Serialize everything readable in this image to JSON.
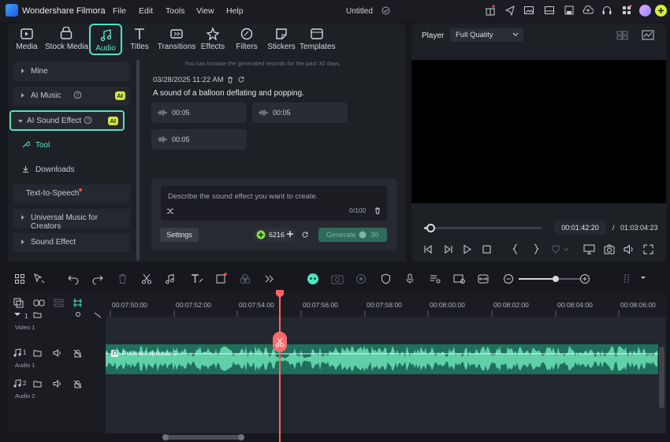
{
  "app": {
    "name": "Wondershare Filmora",
    "menu": [
      "File",
      "Edit",
      "Tools",
      "View",
      "Help"
    ],
    "doc_title": "Untitled"
  },
  "media_tabs": [
    {
      "label": "Media",
      "icon": "media-icon"
    },
    {
      "label": "Stock Media",
      "icon": "stock-media-icon"
    },
    {
      "label": "Audio",
      "icon": "music-note-icon",
      "active": true
    },
    {
      "label": "Titles",
      "icon": "titles-icon"
    },
    {
      "label": "Transitions",
      "icon": "transitions-icon"
    },
    {
      "label": "Effects",
      "icon": "effects-icon"
    },
    {
      "label": "Filters",
      "icon": "filters-icon"
    },
    {
      "label": "Stickers",
      "icon": "stickers-icon"
    },
    {
      "label": "Templates",
      "icon": "templates-icon"
    }
  ],
  "sidebar": {
    "mine": "Mine",
    "ai_music": "AI Music",
    "ai_sound_effect": "AI Sound Effect",
    "ai_badge": "AI",
    "tool": "Tool",
    "downloads": "Downloads",
    "tts": "Text-to-Speech",
    "universal_music": "Universal Music for Creators",
    "sound_effect": "Sound Effect"
  },
  "records": {
    "note": "You can browse the generated records for the past 30 days.",
    "date": "03/28/2025 11:22 AM",
    "description": "A sound of a balloon deflating and popping.",
    "clips": [
      "00:05",
      "00:05",
      "00:05"
    ]
  },
  "prompt": {
    "placeholder": "Describe the sound effect you want to create.",
    "count": "0/100",
    "settings_label": "Settings",
    "credits": "6216",
    "generate_label": "Generate",
    "generate_cost": "30"
  },
  "player": {
    "label": "Player",
    "quality": "Full Quality",
    "current_time": "00:01:42:20",
    "separator": "/",
    "total_time": "01:03:04:23",
    "progress": 0.05
  },
  "timeline": {
    "ticks": [
      "00:07:50:00",
      "00:07:52:00",
      "00:07:54:00",
      "00:07:56:00",
      "00:07:58:00",
      "00:08:00:00",
      "00:08:02:00",
      "00:08:04:00",
      "00:08:06:00"
    ],
    "tracks": [
      {
        "label": "Video 1",
        "number": "1"
      },
      {
        "label": "Audio 1",
        "number": "1"
      },
      {
        "label": "Audio 2",
        "number": "2"
      }
    ],
    "clip_name": "Podcast episode 1"
  },
  "colors": {
    "accent": "#4fe3c3",
    "ai_badge": "#cfe93a",
    "playhead": "#ff6363",
    "waveform": "#5fd0a8"
  }
}
